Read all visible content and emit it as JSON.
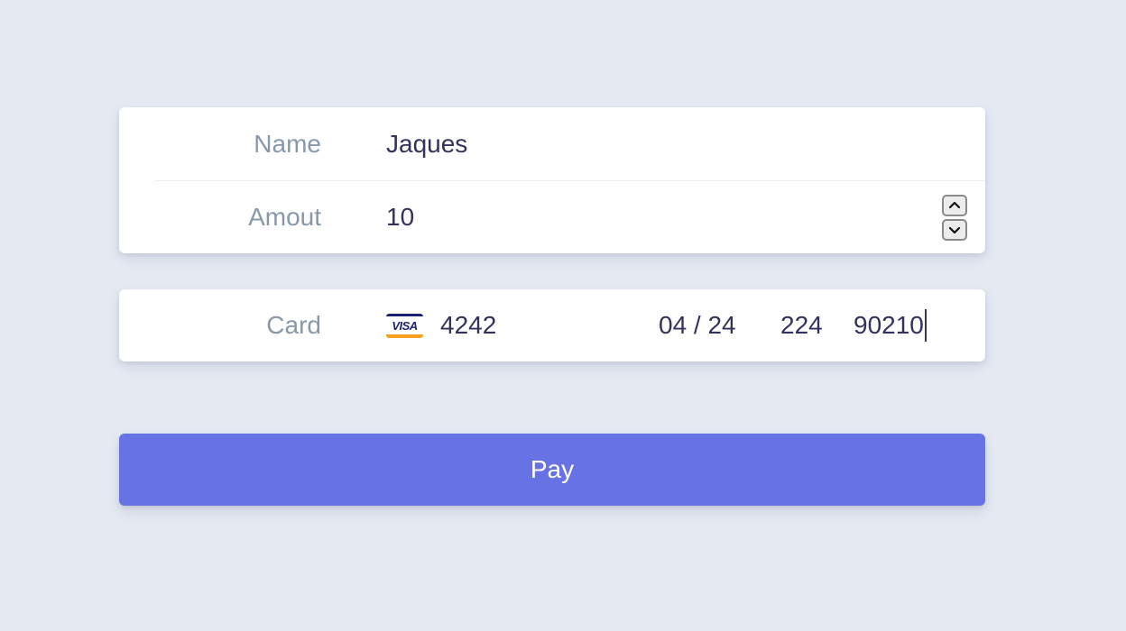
{
  "details": {
    "name_label": "Name",
    "name_value": "Jaques",
    "amount_label": "Amout",
    "amount_value": "10"
  },
  "card": {
    "label": "Card",
    "brand": "VISA",
    "brand_icon": "visa-card-icon",
    "number": "4242",
    "expiry": "04 / 24",
    "cvc": "224",
    "zip": "90210"
  },
  "stepper": {
    "up_icon": "chevron-up-icon",
    "down_icon": "chevron-down-icon"
  },
  "pay": {
    "label": "Pay",
    "color": "#6772e5"
  },
  "colors": {
    "background": "#e4e9f2",
    "label": "#8898aa",
    "value": "#32325d"
  }
}
